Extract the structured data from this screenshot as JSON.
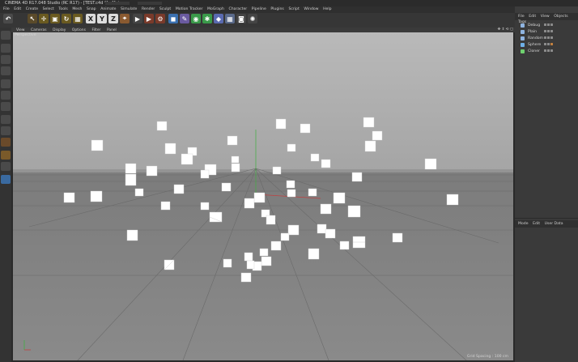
{
  "window": {
    "title": "CINEMA 4D R17.048 Studio (RC R17) - [TEST.c4d *] - Main"
  },
  "menubar": {
    "items": [
      "File",
      "Edit",
      "Create",
      "Select",
      "Tools",
      "Mesh",
      "Snap",
      "Animate",
      "Simulate",
      "Render",
      "Sculpt",
      "Motion Tracker",
      "MoGraph",
      "Character",
      "Pipeline",
      "Plugins",
      "Script",
      "Window",
      "Help"
    ]
  },
  "toolbar": {
    "undo_icon": "undo-icon",
    "x_label": "X",
    "y_label": "Y",
    "z_label": "Z"
  },
  "viewport": {
    "menu": [
      "View",
      "Cameras",
      "Display",
      "Options",
      "Filter",
      "Panel"
    ],
    "camera_label": "Perspective",
    "grid_spacing": "Grid Spacing : 100 cm"
  },
  "object_manager": {
    "menu": [
      "File",
      "Edit",
      "View",
      "Objects",
      "Tags"
    ],
    "objects": [
      {
        "name": "Debug",
        "color": "#8fb4e0"
      },
      {
        "name": "Plain",
        "color": "#8fb4e0"
      },
      {
        "name": "Random",
        "color": "#8fb4e0"
      },
      {
        "name": "Sphere",
        "color": "#6fb0e8"
      },
      {
        "name": "Cloner",
        "color": "#6fd06f"
      }
    ]
  },
  "attributes": {
    "menu": [
      "Mode",
      "Edit",
      "User Data"
    ]
  },
  "colors": {
    "axis_x": "#c04040",
    "axis_y": "#40b040",
    "axis_z": "#4060c0",
    "background_top": "#b8b8b8"
  }
}
